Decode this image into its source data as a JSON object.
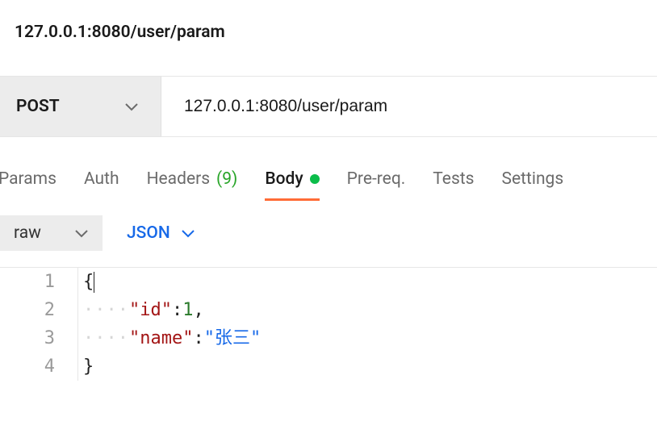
{
  "title": "127.0.0.1:8080/user/param",
  "request": {
    "method": "POST",
    "url": "127.0.0.1:8080/user/param"
  },
  "tabs": {
    "params": "Params",
    "auth": "Auth",
    "headers_prefix": "Headers",
    "headers_count": "(9)",
    "body": "Body",
    "prereq": "Pre-req.",
    "tests": "Tests",
    "settings": "Settings"
  },
  "bodyOptions": {
    "raw": "raw",
    "format": "JSON"
  },
  "editor": {
    "lines": {
      "l1": "{",
      "l2_key": "\"id\"",
      "l2_colon": ":",
      "l2_val": "1",
      "l2_comma": ",",
      "l3_key": "\"name\"",
      "l3_colon": ":",
      "l3_val": "\"张三\"",
      "l4": "}"
    },
    "lineNumbers": {
      "n1": "1",
      "n2": "2",
      "n3": "3",
      "n4": "4"
    },
    "indent": "····"
  }
}
